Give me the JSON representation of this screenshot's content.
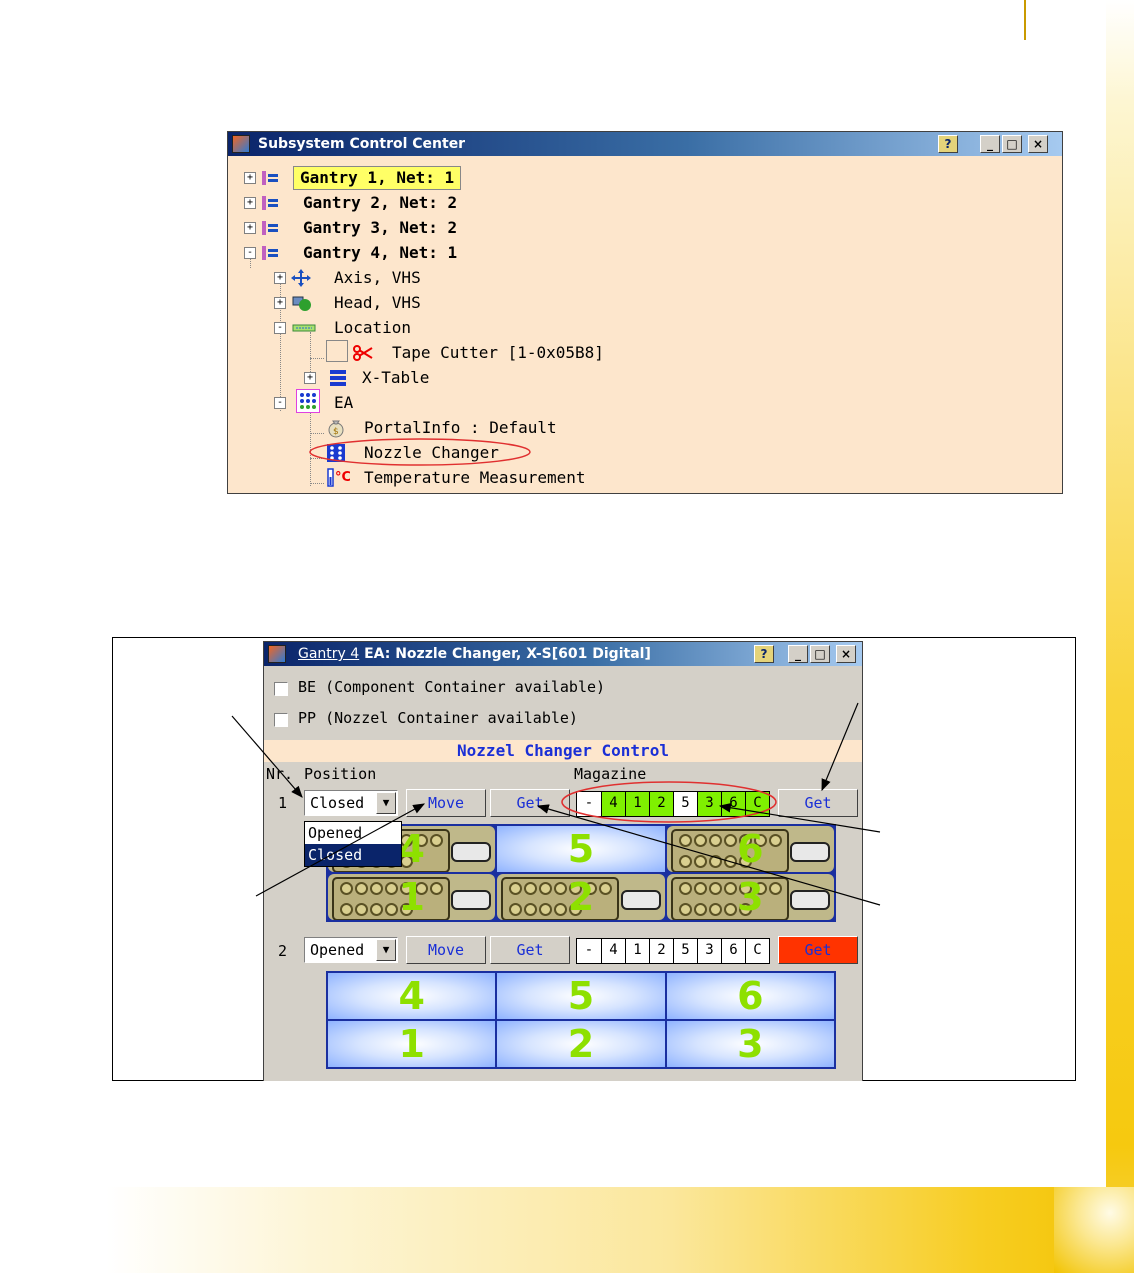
{
  "tree_window": {
    "title": "Subsystem Control Center",
    "buttons": {
      "help": "?",
      "minimize": "_",
      "maximize": "□",
      "close": "×"
    },
    "nodes": [
      {
        "label": "Gantry 1, Net: 1",
        "toggle": "+"
      },
      {
        "label": "Gantry 2, Net: 2",
        "toggle": "+"
      },
      {
        "label": "Gantry 3, Net: 2",
        "toggle": "+"
      },
      {
        "label": "Gantry 4, Net: 1",
        "toggle": "-"
      },
      {
        "label": "Axis, VHS",
        "toggle": "+"
      },
      {
        "label": "Head, VHS",
        "toggle": "+"
      },
      {
        "label": "Location",
        "toggle": "-"
      },
      {
        "label": "Tape Cutter [1-0x05B8]"
      },
      {
        "label": "X-Table",
        "toggle": "+"
      },
      {
        "label": "EA",
        "toggle": "-"
      },
      {
        "label": "PortalInfo : Default"
      },
      {
        "label": "Nozzle Changer"
      },
      {
        "label": "Temperature Measurement"
      }
    ]
  },
  "nozzle_window": {
    "title_link": "Gantry 4",
    "title_rest": " EA: Nozzle Changer, X-S[601 Digital]",
    "buttons": {
      "help": "?",
      "minimize": "_",
      "maximize": "□",
      "close": "×"
    },
    "checkbox_be": "BE (Component Container available)",
    "checkbox_pp": "PP (Nozzel Container available)",
    "section_title": "Nozzel Changer Control",
    "col_nr": "Nr.",
    "col_position": "Position",
    "col_magazine": "Magazine",
    "rows": [
      {
        "nr": "1",
        "position": "Closed",
        "move": "Move",
        "get": "Get",
        "magazine": [
          "-",
          "4",
          "1",
          "2",
          "5",
          "3",
          "6",
          "C"
        ],
        "magazine_get": "Get",
        "slots": [
          "4",
          "5",
          "6",
          "1",
          "2",
          "3"
        ]
      },
      {
        "nr": "2",
        "position": "Opened",
        "move": "Move",
        "get": "Get",
        "magazine": [
          "-",
          "4",
          "1",
          "2",
          "5",
          "3",
          "6",
          "C"
        ],
        "magazine_get": "Get",
        "slots": [
          "4",
          "5",
          "6",
          "1",
          "2",
          "3"
        ]
      }
    ],
    "dropdown_options": [
      "Opened",
      "Closed"
    ]
  },
  "colors": {
    "magazine_active": "#7ff000",
    "get_alert": "#ff3300",
    "slot_number": "#8ee000",
    "tree_bg": "#fde6cc",
    "section_text": "#1a2fd6"
  }
}
